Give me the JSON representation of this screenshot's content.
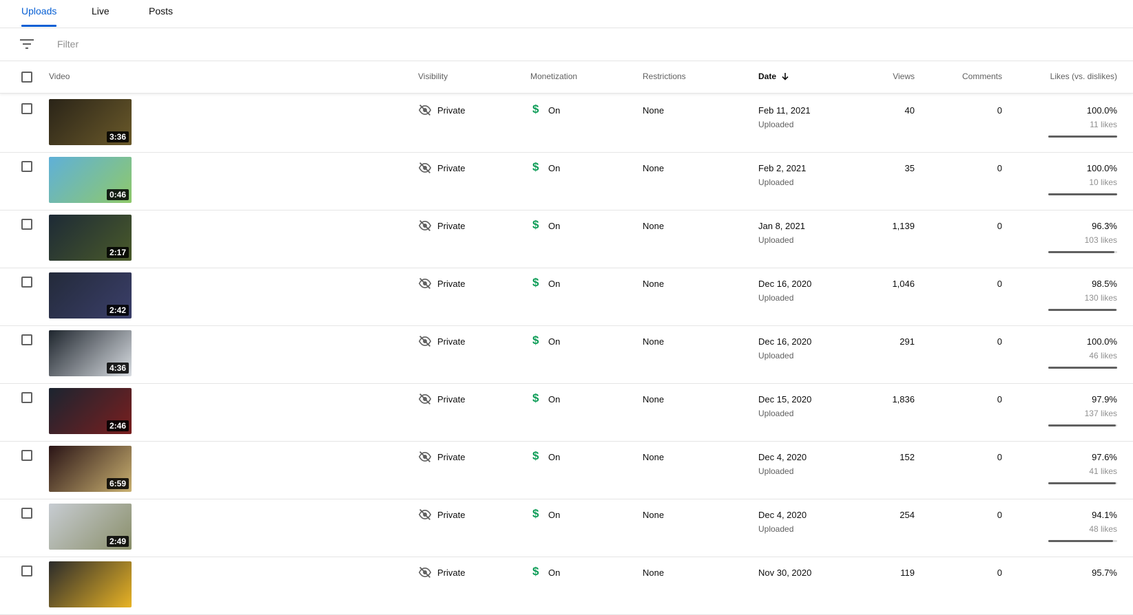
{
  "tabs": [
    {
      "label": "Uploads",
      "active": true
    },
    {
      "label": "Live",
      "active": false
    },
    {
      "label": "Posts",
      "active": false
    }
  ],
  "filter": {
    "placeholder": "Filter",
    "icon": "filter-list-icon"
  },
  "columns": {
    "video": "Video",
    "visibility": "Visibility",
    "monetization": "Monetization",
    "restrictions": "Restrictions",
    "date": "Date",
    "views": "Views",
    "comments": "Comments",
    "likes": "Likes (vs. dislikes)"
  },
  "sort": {
    "column": "date",
    "direction": "descending",
    "icon": "arrow-down-icon"
  },
  "colors": {
    "accent": "#065fd4",
    "monetization": "#0f9d58"
  },
  "rows": [
    {
      "duration": "3:36",
      "visibility": "Private",
      "monetization": "On",
      "restrictions": "None",
      "date": "Feb 11, 2021",
      "status": "Uploaded",
      "views": "40",
      "comments": "0",
      "likes_pct": "100.0%",
      "likes_count": "11 likes",
      "ratio": 1.0,
      "thumb_colors": [
        "#2a2418",
        "#6b5a2a"
      ]
    },
    {
      "duration": "0:46",
      "visibility": "Private",
      "monetization": "On",
      "restrictions": "None",
      "date": "Feb 2, 2021",
      "status": "Uploaded",
      "views": "35",
      "comments": "0",
      "likes_pct": "100.0%",
      "likes_count": "10 likes",
      "ratio": 1.0,
      "thumb_colors": [
        "#5fb0d8",
        "#8fc96a"
      ]
    },
    {
      "duration": "2:17",
      "visibility": "Private",
      "monetization": "On",
      "restrictions": "None",
      "date": "Jan 8, 2021",
      "status": "Uploaded",
      "views": "1,139",
      "comments": "0",
      "likes_pct": "96.3%",
      "likes_count": "103 likes",
      "ratio": 0.963,
      "thumb_colors": [
        "#1d2a36",
        "#4a5a2a"
      ]
    },
    {
      "duration": "2:42",
      "visibility": "Private",
      "monetization": "On",
      "restrictions": "None",
      "date": "Dec 16, 2020",
      "status": "Uploaded",
      "views": "1,046",
      "comments": "0",
      "likes_pct": "98.5%",
      "likes_count": "130 likes",
      "ratio": 0.985,
      "thumb_colors": [
        "#232a3a",
        "#3b3f6a"
      ]
    },
    {
      "duration": "4:36",
      "visibility": "Private",
      "monetization": "On",
      "restrictions": "None",
      "date": "Dec 16, 2020",
      "status": "Uploaded",
      "views": "291",
      "comments": "0",
      "likes_pct": "100.0%",
      "likes_count": "46 likes",
      "ratio": 1.0,
      "thumb_colors": [
        "#1f262e",
        "#d9dde2"
      ]
    },
    {
      "duration": "2:46",
      "visibility": "Private",
      "monetization": "On",
      "restrictions": "None",
      "date": "Dec 15, 2020",
      "status": "Uploaded",
      "views": "1,836",
      "comments": "0",
      "likes_pct": "97.9%",
      "likes_count": "137 likes",
      "ratio": 0.979,
      "thumb_colors": [
        "#1b2430",
        "#7a1f1f"
      ]
    },
    {
      "duration": "6:59",
      "visibility": "Private",
      "monetization": "On",
      "restrictions": "None",
      "date": "Dec 4, 2020",
      "status": "Uploaded",
      "views": "152",
      "comments": "0",
      "likes_pct": "97.6%",
      "likes_count": "41 likes",
      "ratio": 0.976,
      "thumb_colors": [
        "#2a1416",
        "#c9b070"
      ]
    },
    {
      "duration": "2:49",
      "visibility": "Private",
      "monetization": "On",
      "restrictions": "None",
      "date": "Dec 4, 2020",
      "status": "Uploaded",
      "views": "254",
      "comments": "0",
      "likes_pct": "94.1%",
      "likes_count": "48 likes",
      "ratio": 0.941,
      "thumb_colors": [
        "#c7ccd2",
        "#8a8f6a"
      ]
    },
    {
      "duration": "",
      "visibility": "Private",
      "monetization": "On",
      "restrictions": "None",
      "date": "Nov 30, 2020",
      "status": "",
      "views": "119",
      "comments": "0",
      "likes_pct": "95.7%",
      "likes_count": "",
      "ratio": 0.957,
      "thumb_colors": [
        "#2b2b2b",
        "#e8b325"
      ]
    }
  ]
}
